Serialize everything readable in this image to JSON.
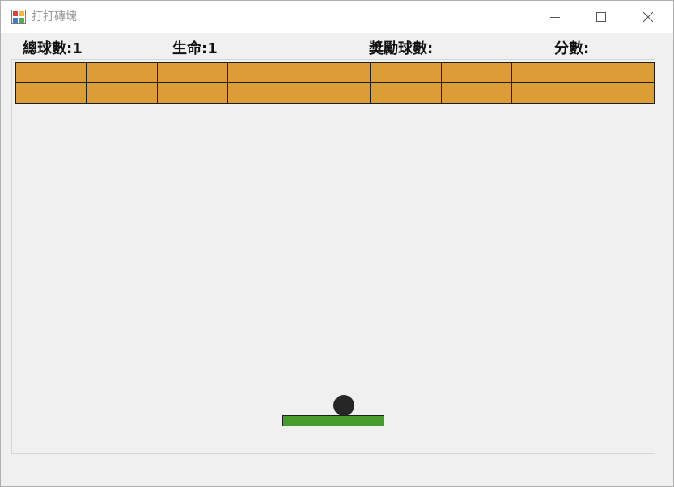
{
  "window": {
    "title": "打打磚塊",
    "icon": "app-window-icon",
    "controls": [
      "minimize-icon",
      "maximize-icon",
      "close-icon"
    ]
  },
  "hud": {
    "total_balls_label": "總球數:1",
    "lives_label": "生命:1",
    "bonus_balls_label": "獎勵球數:",
    "score_label": "分數:"
  },
  "game": {
    "brick_rows": 2,
    "brick_cols": 9,
    "colors": {
      "brick": "#dc9d37",
      "brick_border": "#1e1e1e",
      "ball": "#262626",
      "paddle": "#469b2a",
      "background": "#f0f0f0"
    }
  }
}
